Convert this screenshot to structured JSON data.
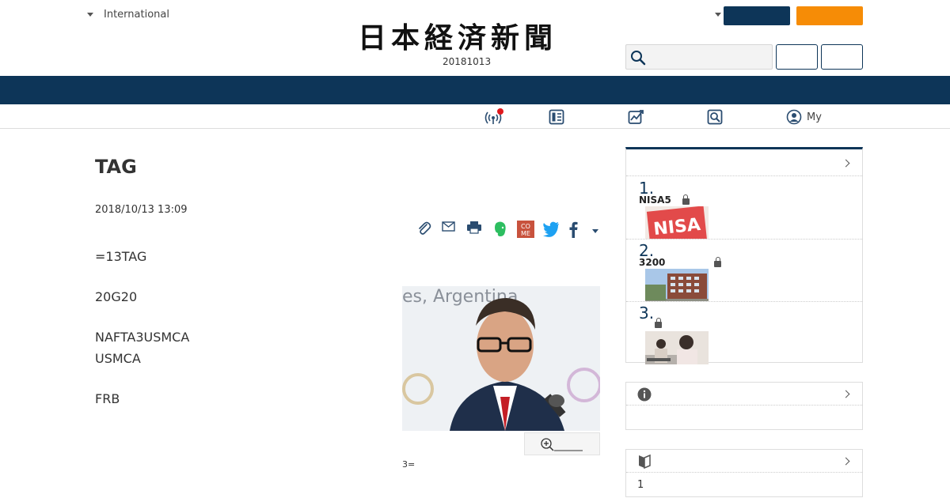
{
  "header": {
    "region_label": "International",
    "logo_text": "日本経済新聞",
    "date_text": "20181013"
  },
  "article": {
    "title": "TAG",
    "published": "2018/10/13 13:09",
    "paragraphs": [
      "=13TAG",
      "20G20",
      "NAFTA3USMCA\nUSMCA",
      "FRB"
    ],
    "photo_caption": "3=",
    "photo_backdrop_text": "es, Argentina"
  },
  "sidebar": {
    "ranking": [
      {
        "num": "1.",
        "title": "NISA5",
        "thumb_text": "NISA"
      },
      {
        "num": "2.",
        "title": "3200"
      },
      {
        "num": "3.",
        "title": ""
      }
    ],
    "box3_text": "1"
  },
  "nav": {
    "my_label": "My"
  },
  "colors": {
    "navy": "#0d3558",
    "orange": "#f68c06",
    "alert_red": "#e0191d"
  },
  "icons": [
    "caret-down-icon",
    "search-icon",
    "live-icon",
    "paper-icon",
    "chart-icon",
    "search-news-icon",
    "user-icon",
    "clip-icon",
    "mail-icon",
    "print-icon",
    "evernote-icon",
    "come-icon",
    "twitter-icon",
    "facebook-icon",
    "zoom-icon",
    "info-icon",
    "beginner-icon",
    "lock-icon"
  ]
}
